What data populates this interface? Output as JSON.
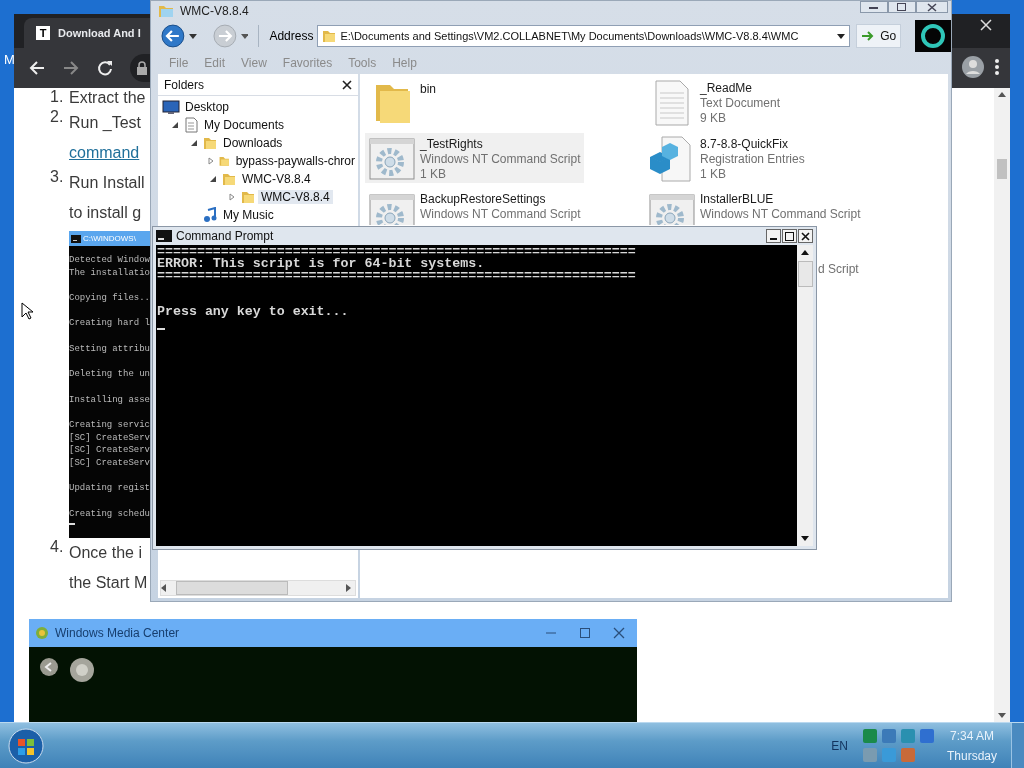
{
  "desktop": {
    "edge_label": "M"
  },
  "browser": {
    "favicon": "T",
    "tab_title": "Download And I",
    "article": [
      {
        "kind": "step",
        "number": "1.",
        "lines": [
          {
            "kind": "text",
            "text": "Extract the"
          }
        ]
      },
      {
        "kind": "step",
        "number": "2.",
        "lines": [
          {
            "kind": "text",
            "text": "Run _Test"
          },
          {
            "kind": "link",
            "text": "command"
          }
        ]
      },
      {
        "kind": "step",
        "number": "3.",
        "lines": [
          {
            "kind": "text",
            "text": "Run Install"
          },
          {
            "kind": "text",
            "text": "to install g"
          }
        ]
      },
      {
        "kind": "console",
        "title": "C:\\WINDOWS\\",
        "blocks": [
          [
            "Detected Window",
            "The installatio"
          ],
          [
            "Copying files.."
          ],
          [
            "Creating hard l"
          ],
          [
            "Setting attribu"
          ],
          [
            "Deleting the un"
          ],
          [
            "Installing asse"
          ],
          [
            "Creating servic",
            "[SC] CreateServ",
            "[SC] CreateServ",
            "[SC] CreateServ"
          ],
          [
            "Updating regist"
          ],
          [
            "Creating schedu"
          ]
        ]
      },
      {
        "kind": "step",
        "number": "4.",
        "lines": [
          {
            "kind": "text",
            "text": "Once the i"
          },
          {
            "kind": "text",
            "text": "the Start M"
          }
        ]
      },
      {
        "kind": "media_window",
        "title": "Windows Media Center"
      }
    ]
  },
  "explorer": {
    "title": "WMC-V8.8.4",
    "address_label": "Address",
    "address": "E:\\Documents and Settings\\VM2.COLLABNET\\My Documents\\Downloads\\WMC-V8.8.4\\WMC",
    "go": "Go",
    "menu": [
      "File",
      "Edit",
      "View",
      "Favorites",
      "Tools",
      "Help"
    ],
    "folders": {
      "title": "Folders",
      "tree": [
        {
          "label": "Desktop",
          "kind": "desktop",
          "selected": false,
          "children": [
            {
              "label": "My Documents",
              "kind": "documents",
              "expanded": true,
              "selected": false,
              "children": [
                {
                  "label": "Downloads",
                  "kind": "folder",
                  "expanded": true,
                  "selected": false,
                  "children": [
                    {
                      "label": "bypass-paywalls-chror",
                      "kind": "folder",
                      "expanded": false,
                      "selected": false
                    },
                    {
                      "label": "WMC-V8.8.4",
                      "kind": "folder",
                      "expanded": true,
                      "selected": false,
                      "children": [
                        {
                          "label": "WMC-V8.8.4",
                          "kind": "folder",
                          "expanded": false,
                          "selected": true
                        }
                      ]
                    }
                  ]
                },
                {
                  "label": "My Music",
                  "kind": "music",
                  "selected": false
                }
              ]
            }
          ]
        }
      ]
    },
    "files": [
      {
        "name": "bin",
        "kind": "folder",
        "selected": false
      },
      {
        "name": "_ReadMe",
        "type": "Text Document",
        "size": "9 KB",
        "kind": "text",
        "selected": false
      },
      {
        "name": "_TestRights",
        "type": "Windows NT Command Script",
        "size": "1 KB",
        "kind": "script",
        "selected": true
      },
      {
        "name": "8.7-8.8-QuickFix",
        "type": "Registration Entries",
        "size": "1 KB",
        "kind": "registry",
        "selected": false
      },
      {
        "name": "BackupRestoreSettings",
        "type": "Windows NT Command Script",
        "kind": "script",
        "selected": false
      },
      {
        "name": "InstallerBLUE",
        "type": "Windows NT Command Script",
        "kind": "script",
        "selected": false
      }
    ],
    "partial_type": "d Script"
  },
  "cmd": {
    "title": "Command Prompt",
    "lines": [
      "============================================================",
      "ERROR: This script is for 64-bit systems.",
      "============================================================"
    ],
    "prompt": "Press any key to exit..."
  },
  "taskbar": {
    "language": "EN",
    "time": "7:34 AM",
    "day": "Thursday"
  }
}
